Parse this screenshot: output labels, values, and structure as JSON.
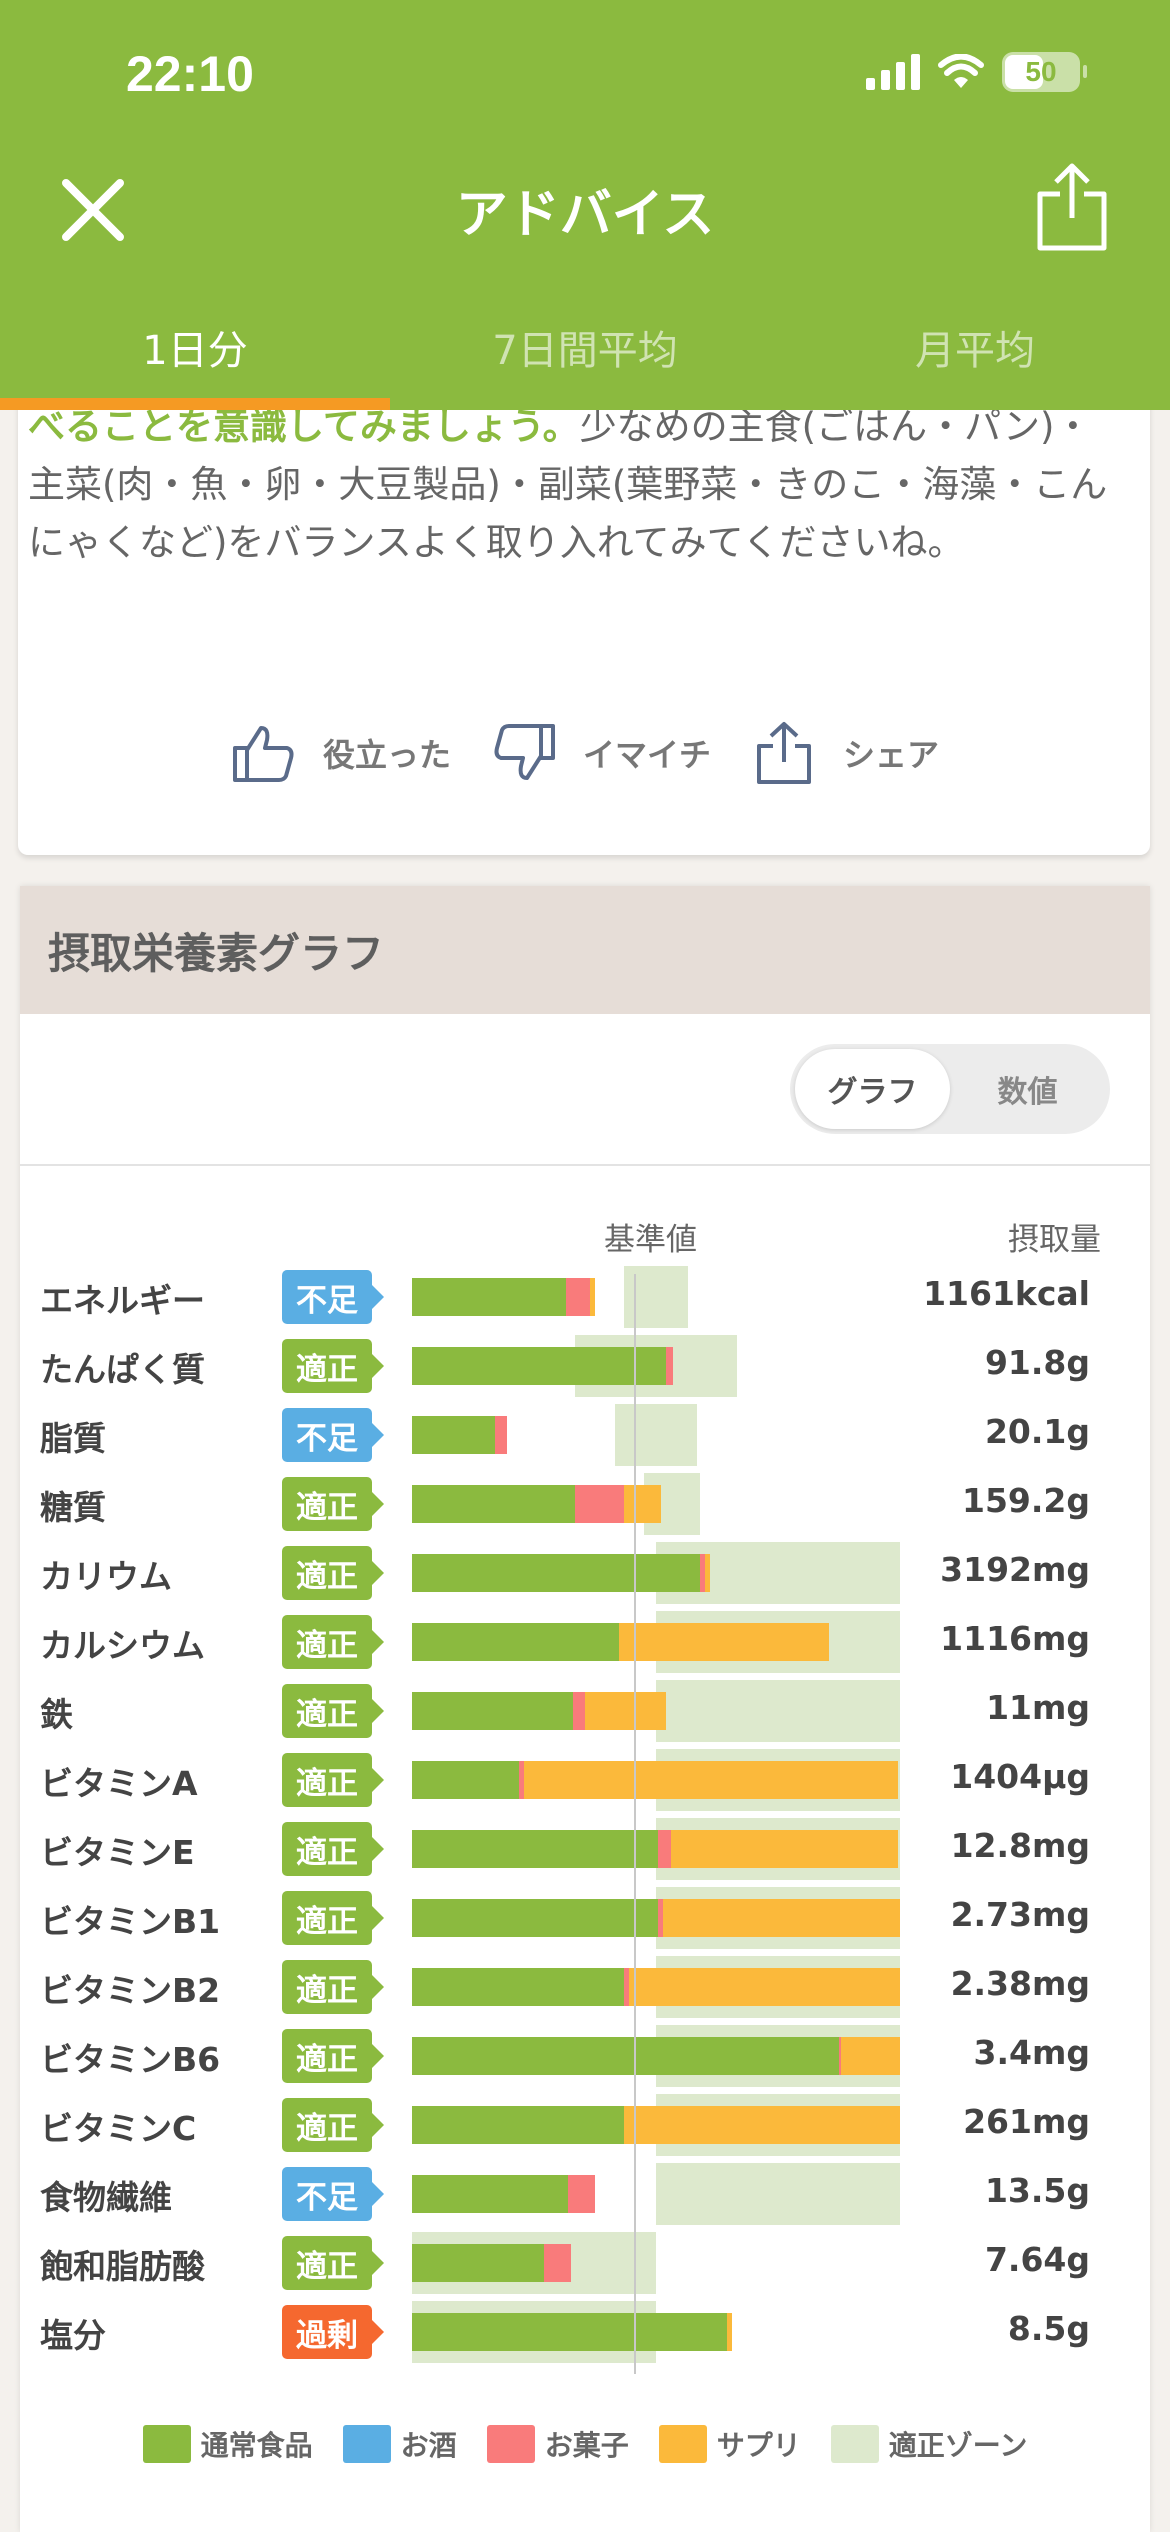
{
  "status": {
    "time": "22:10",
    "battery": "50"
  },
  "nav": {
    "title": "アドバイス"
  },
  "tabs": [
    "1日分",
    "7日間平均",
    "月平均"
  ],
  "advice": {
    "highlight": "べることを意識してみましょう。",
    "text": "少なめの主食(ごはん・パン)・主菜(肉・魚・卵・大豆製品)・副菜(葉野菜・きのこ・海藻・こんにゃくなど)をバランスよく取り入れてみてくださいね。"
  },
  "feedback": {
    "useful": "役立った",
    "meh": "イマイチ",
    "share": "シェア"
  },
  "graph": {
    "title": "摂取栄養素グラフ",
    "toggle": {
      "graph": "グラフ",
      "number": "数値"
    },
    "baseline_label": "基準値",
    "intake_label": "摂取量"
  },
  "colors": {
    "normal": "#8bba3f",
    "alcohol": "#5aaee3",
    "snack": "#f97b7b",
    "supplement": "#fbb93b",
    "zone": "#dde9cd"
  },
  "chart_data": {
    "type": "bar",
    "unit_note": "fraction of 基準値 (1.0 = baseline line)",
    "rows": [
      {
        "name": "エネルギー",
        "status": "不足",
        "level": "low",
        "value": "1161kcal",
        "normal": 0.63,
        "snack": 0.1,
        "supp": 0.02,
        "zone": [
          0.87,
          1.13
        ]
      },
      {
        "name": "たんぱく質",
        "status": "適正",
        "level": "ok",
        "value": "91.8g",
        "normal": 1.04,
        "snack": 0.03,
        "supp": 0.0,
        "zone": [
          0.67,
          1.33
        ]
      },
      {
        "name": "脂質",
        "status": "不足",
        "level": "low",
        "value": "20.1g",
        "normal": 0.34,
        "snack": 0.05,
        "supp": 0.0,
        "zone": [
          0.83,
          1.17
        ]
      },
      {
        "name": "糖質",
        "status": "適正",
        "level": "ok",
        "value": "159.2g",
        "normal": 0.67,
        "snack": 0.2,
        "supp": 0.15,
        "zone": [
          0.95,
          1.18
        ]
      },
      {
        "name": "カリウム",
        "status": "適正",
        "level": "ok",
        "value": "3192mg",
        "normal": 1.18,
        "snack": 0.02,
        "supp": 0.02,
        "zone": [
          1.0,
          2.0
        ]
      },
      {
        "name": "カルシウム",
        "status": "適正",
        "level": "ok",
        "value": "1116mg",
        "normal": 0.85,
        "snack": 0.0,
        "supp": 0.86,
        "zone": [
          1.0,
          2.0
        ]
      },
      {
        "name": "鉄",
        "status": "適正",
        "level": "ok",
        "value": "11mg",
        "normal": 0.66,
        "snack": 0.05,
        "supp": 0.33,
        "zone": [
          1.0,
          2.0
        ]
      },
      {
        "name": "ビタミンA",
        "status": "適正",
        "level": "ok",
        "value": "1404μg",
        "normal": 0.44,
        "snack": 0.02,
        "supp": 1.53,
        "zone": [
          1.0,
          2.0
        ]
      },
      {
        "name": "ビタミンE",
        "status": "適正",
        "level": "ok",
        "value": "12.8mg",
        "normal": 1.01,
        "snack": 0.05,
        "supp": 0.93,
        "zone": [
          1.0,
          2.0
        ]
      },
      {
        "name": "ビタミンB1",
        "status": "適正",
        "level": "ok",
        "value": "2.73mg",
        "normal": 1.01,
        "snack": 0.02,
        "supp": 0.97,
        "zone": [
          1.0,
          2.0
        ]
      },
      {
        "name": "ビタミンB2",
        "status": "適正",
        "level": "ok",
        "value": "2.38mg",
        "normal": 0.87,
        "snack": 0.02,
        "supp": 1.11,
        "zone": [
          1.0,
          2.0
        ]
      },
      {
        "name": "ビタミンB6",
        "status": "適正",
        "level": "ok",
        "value": "3.4mg",
        "normal": 1.75,
        "snack": 0.01,
        "supp": 0.24,
        "zone": [
          1.0,
          2.0
        ]
      },
      {
        "name": "ビタミンC",
        "status": "適正",
        "level": "ok",
        "value": "261mg",
        "normal": 0.87,
        "snack": 0.0,
        "supp": 1.13,
        "zone": [
          1.0,
          2.0
        ]
      },
      {
        "name": "食物繊維",
        "status": "不足",
        "level": "low",
        "value": "13.5g",
        "normal": 0.64,
        "snack": 0.11,
        "supp": 0.0,
        "zone": [
          1.0,
          2.0
        ]
      },
      {
        "name": "飽和脂肪酸",
        "status": "適正",
        "level": "ok",
        "value": "7.64g",
        "normal": 0.54,
        "snack": 0.11,
        "supp": 0.0,
        "zone": [
          0.0,
          1.0
        ]
      },
      {
        "name": "塩分",
        "status": "過剰",
        "level": "over",
        "value": "8.5g",
        "normal": 1.29,
        "snack": 0.0,
        "supp": 0.02,
        "zone": [
          0.0,
          1.0
        ]
      }
    ]
  },
  "legend": [
    {
      "label": "通常食品",
      "color": "#8bba3f"
    },
    {
      "label": "お酒",
      "color": "#5aaee3"
    },
    {
      "label": "お菓子",
      "color": "#f97b7b"
    },
    {
      "label": "サプリ",
      "color": "#fbb93b"
    },
    {
      "label": "適正ゾーン",
      "color": "#dde9cd"
    }
  ]
}
